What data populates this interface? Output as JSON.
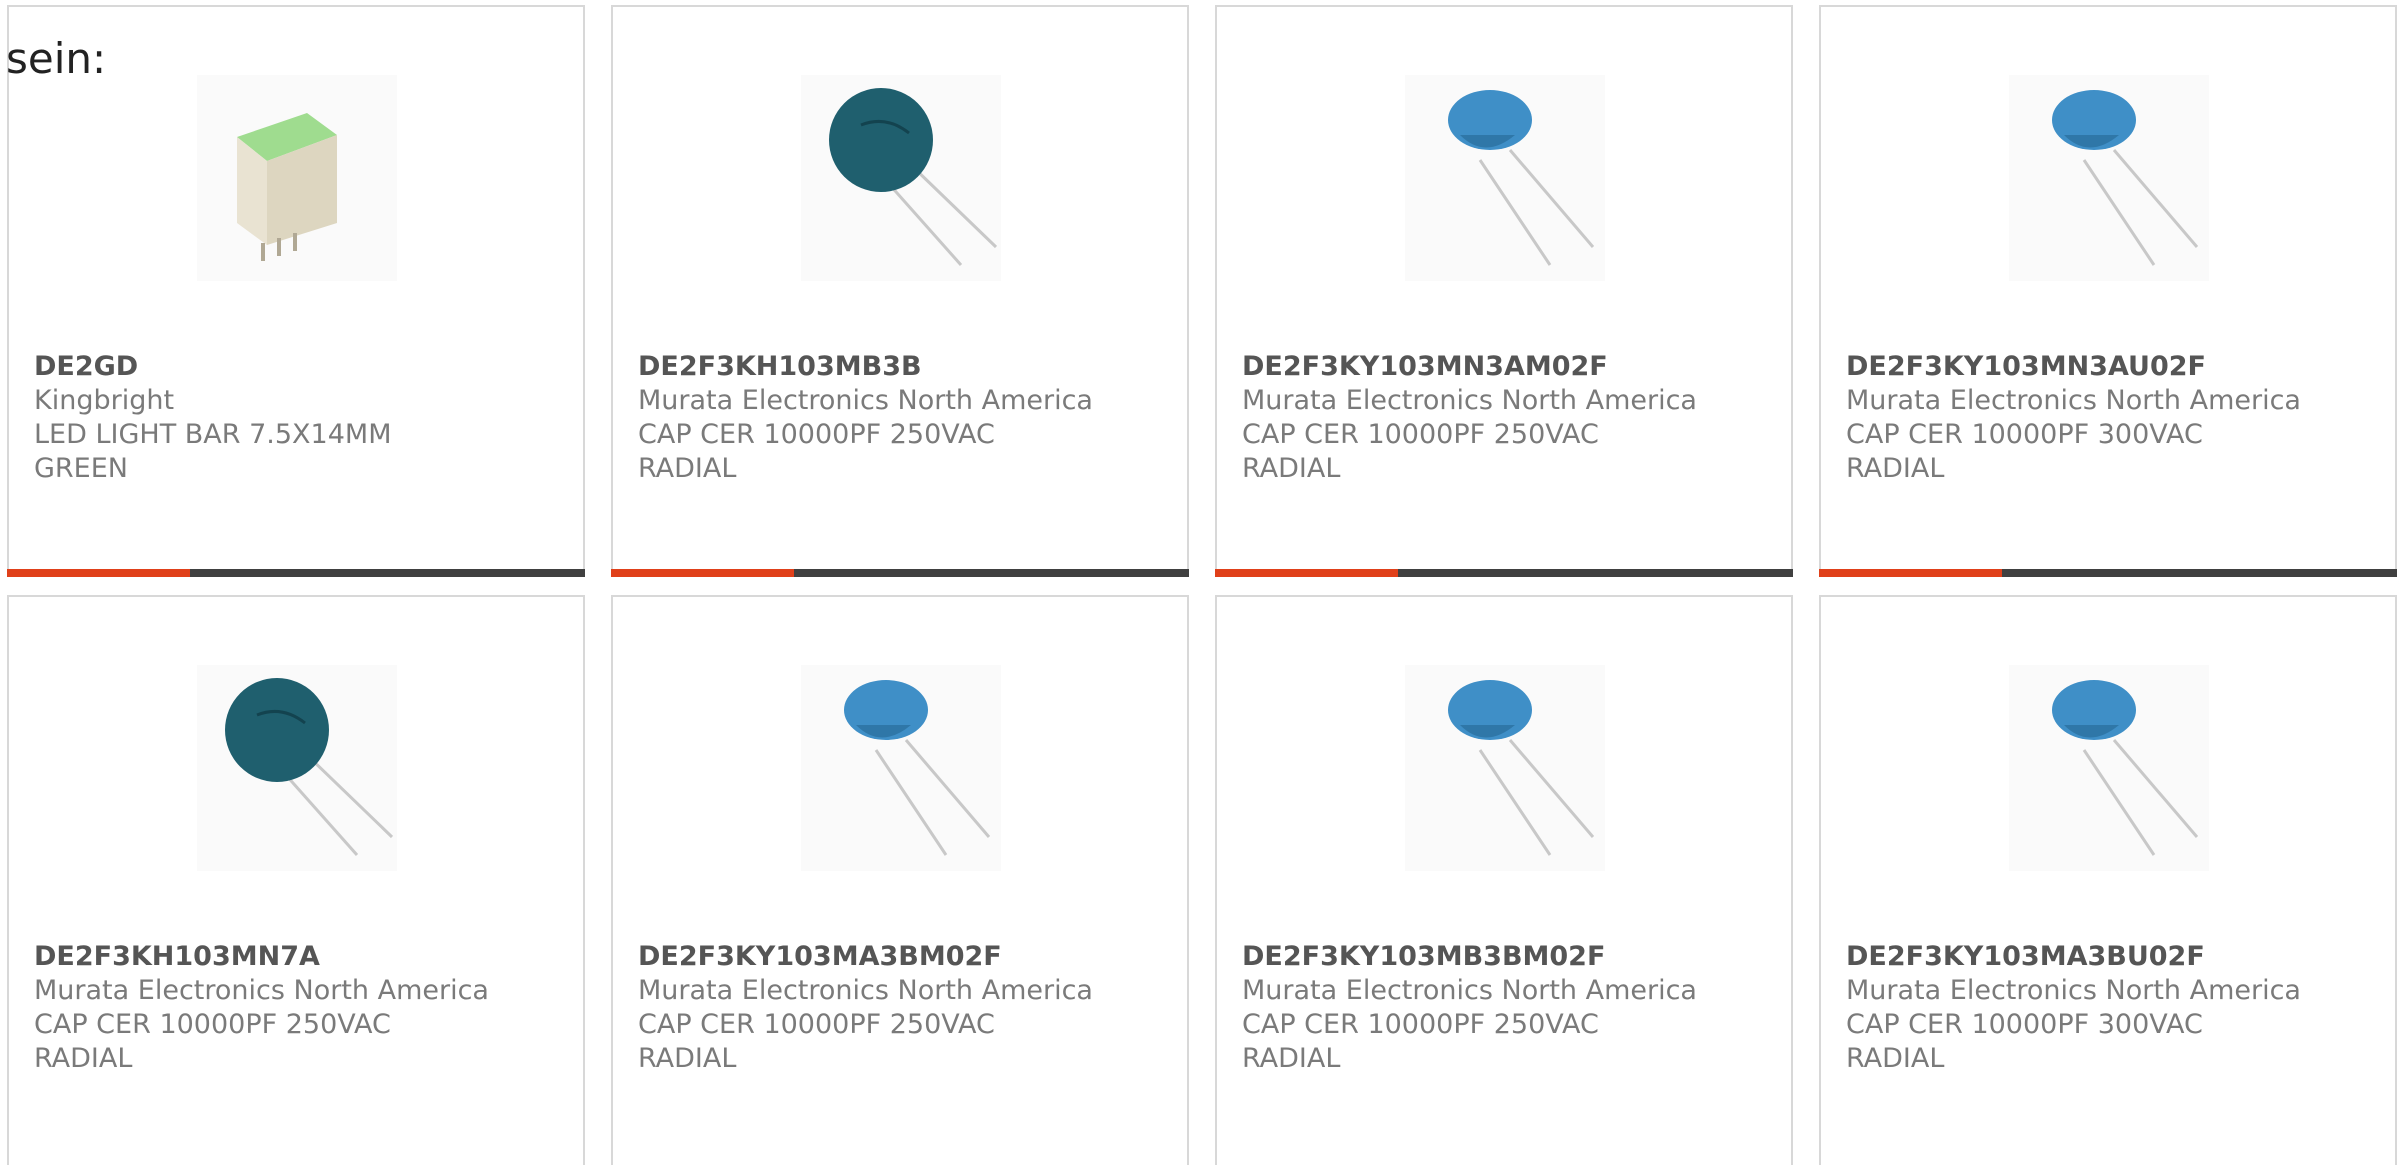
{
  "intro_text": "sein:",
  "colors": {
    "accent": "#e0401a",
    "bar": "#404040",
    "part_text": "#555555",
    "body_text": "#7a7a7a"
  },
  "products": [
    {
      "part": "DE2GD",
      "manufacturer": "Kingbright",
      "desc1": "LED LIGHT BAR 7.5X14MM",
      "desc2": "GREEN",
      "image": "led-light-bar-icon"
    },
    {
      "part": "DE2F3KH103MB3B",
      "manufacturer": "Murata Electronics North America",
      "desc1": "CAP CER 10000PF 250VAC",
      "desc2": "RADIAL",
      "image": "dark-disc-capacitor-icon"
    },
    {
      "part": "DE2F3KY103MN3AM02F",
      "manufacturer": "Murata Electronics North America",
      "desc1": "CAP CER 10000PF 250VAC",
      "desc2": "RADIAL",
      "image": "blue-disc-capacitor-icon"
    },
    {
      "part": "DE2F3KY103MN3AU02F",
      "manufacturer": "Murata Electronics North America",
      "desc1": "CAP CER 10000PF 300VAC",
      "desc2": "RADIAL",
      "image": "blue-disc-capacitor-icon"
    },
    {
      "part": "DE2F3KH103MN7A",
      "manufacturer": "Murata Electronics North America",
      "desc1": "CAP CER 10000PF 250VAC",
      "desc2": "RADIAL",
      "image": "dark-disc-capacitor-icon"
    },
    {
      "part": "DE2F3KY103MA3BM02F",
      "manufacturer": "Murata Electronics North America",
      "desc1": "CAP CER 10000PF 250VAC",
      "desc2": "RADIAL",
      "image": "blue-disc-capacitor-icon"
    },
    {
      "part": "DE2F3KY103MB3BM02F",
      "manufacturer": "Murata Electronics North America",
      "desc1": "CAP CER 10000PF 250VAC",
      "desc2": "RADIAL",
      "image": "blue-disc-capacitor-icon"
    },
    {
      "part": "DE2F3KY103MA3BU02F",
      "manufacturer": "Murata Electronics North America",
      "desc1": "CAP CER 10000PF 300VAC",
      "desc2": "RADIAL",
      "image": "blue-disc-capacitor-icon"
    }
  ]
}
